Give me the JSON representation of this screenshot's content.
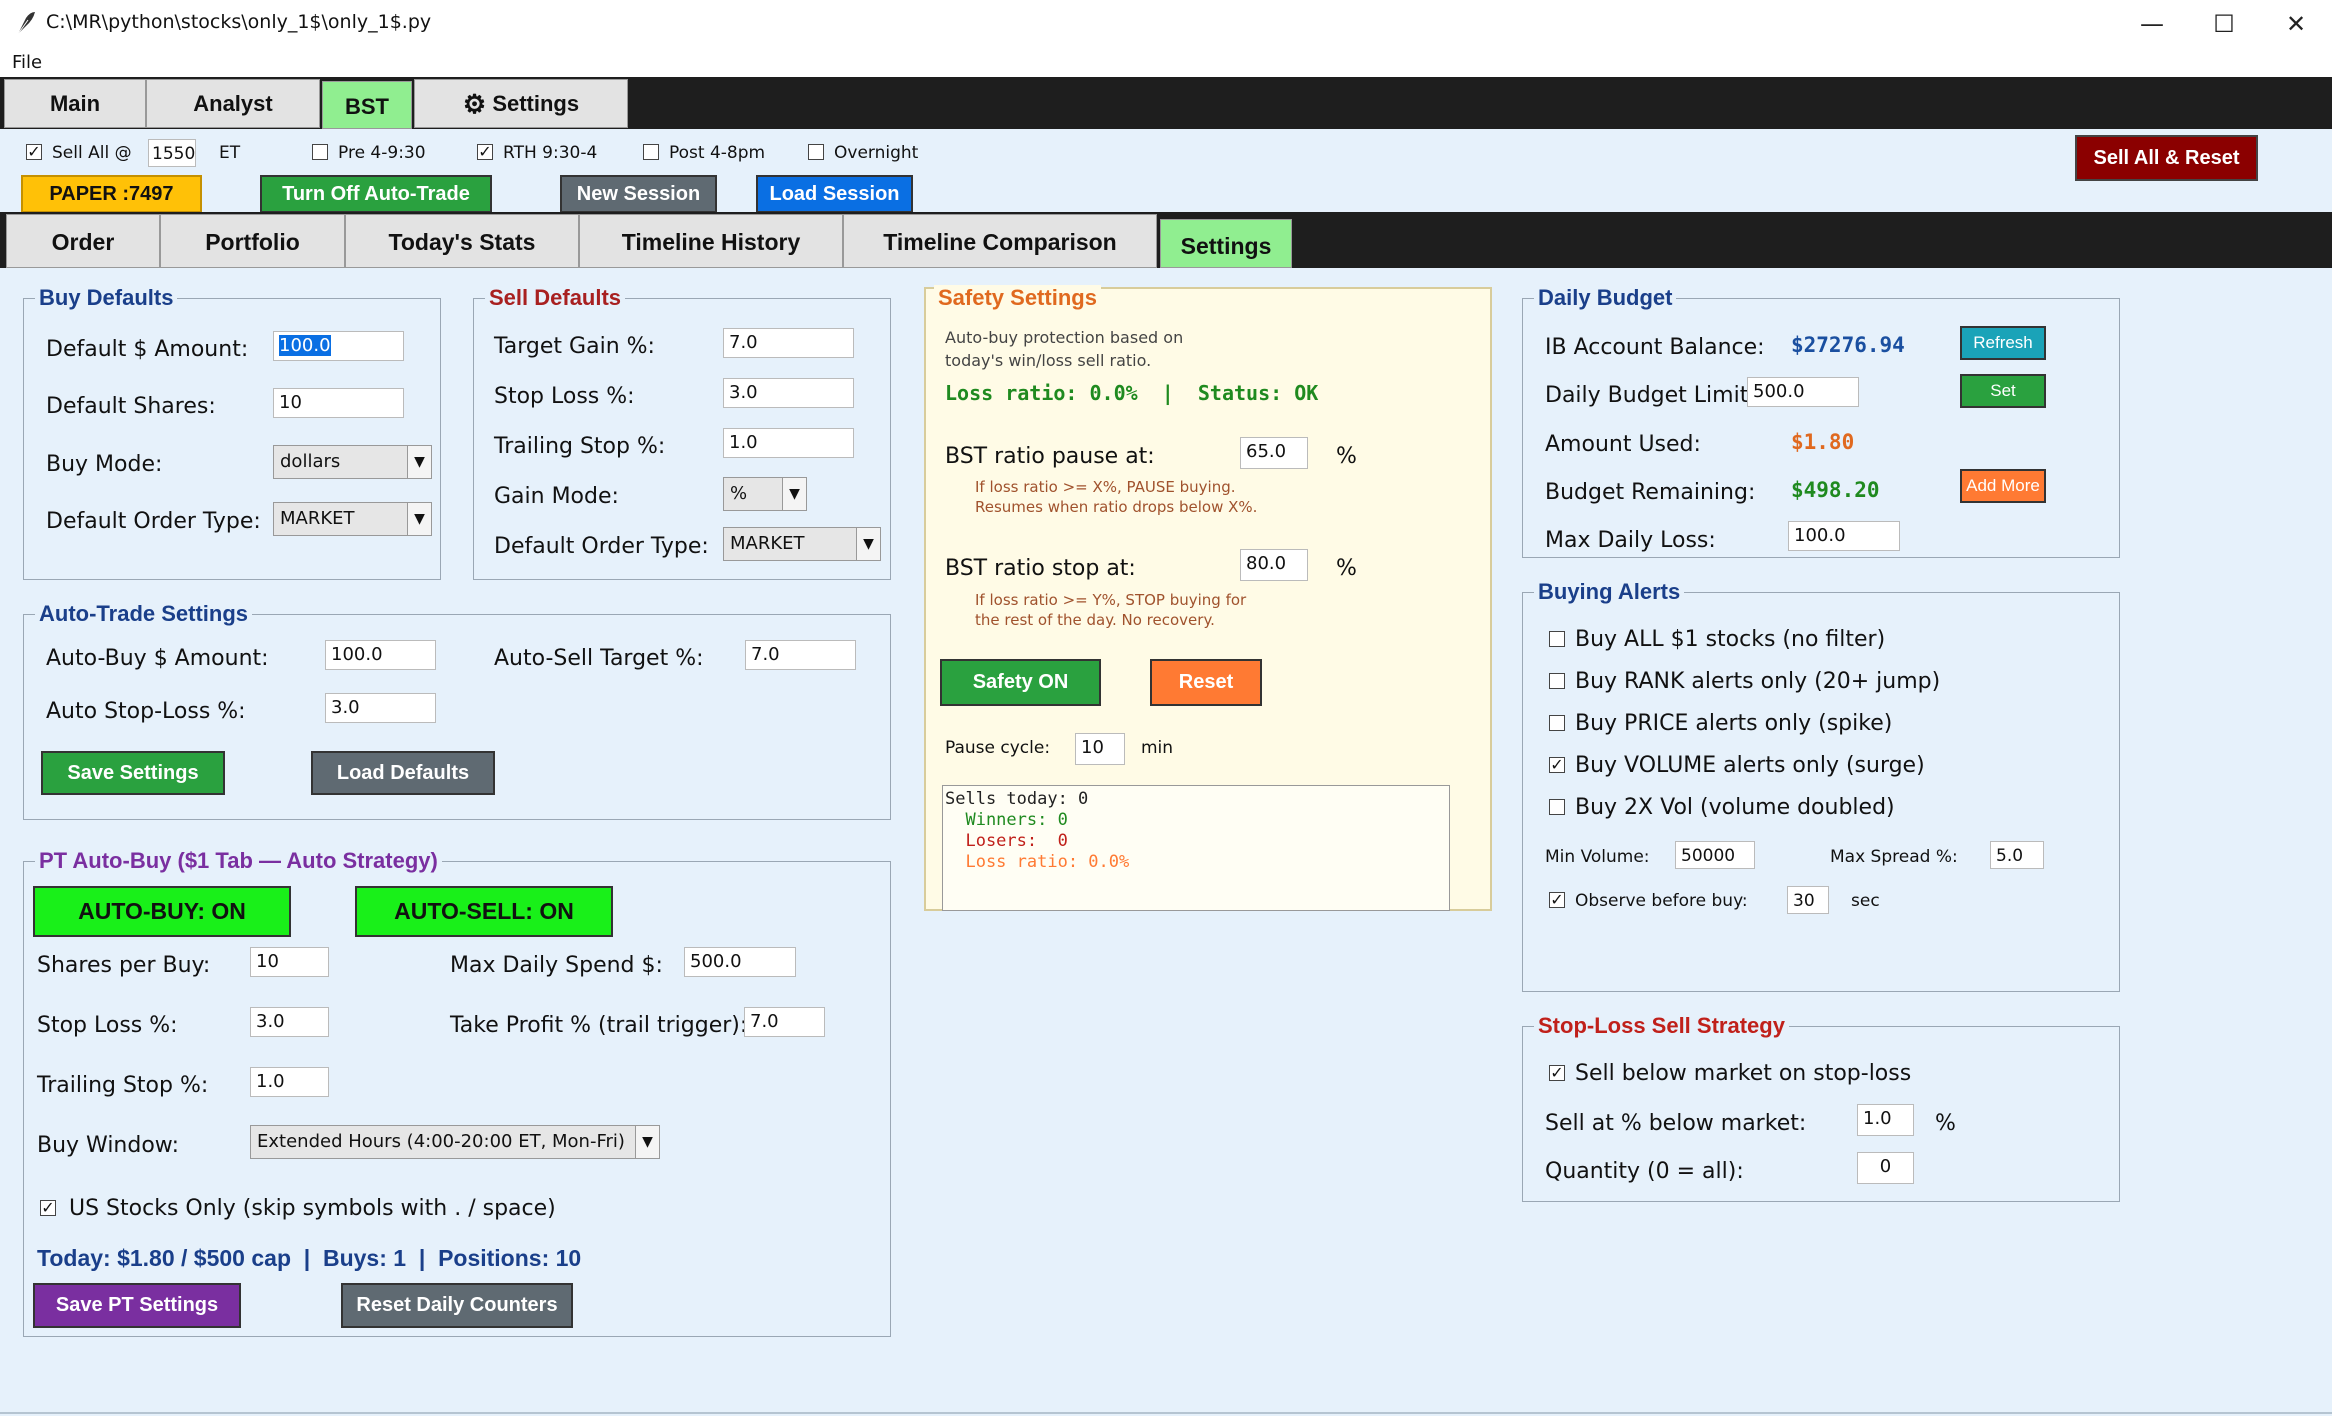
{
  "window": {
    "title": "C:\\MR\\python\\stocks\\only_1$\\only_1$.py",
    "minimize": "—",
    "maximize": "☐",
    "close": "✕"
  },
  "menu": {
    "file": "File"
  },
  "main_tabs": [
    "Main",
    "Analyst",
    "BST",
    "Settings"
  ],
  "gear_glyph": "⚙",
  "toolbar": {
    "sell_all_label": "Sell All @",
    "sell_all_time": "1550",
    "et": "ET",
    "pre": "Pre 4-9:30",
    "rth": "RTH 9:30-4",
    "post": "Post 4-8pm",
    "overnight": "Overnight",
    "sell_all_reset": "Sell All & Reset",
    "paper": "PAPER :7497",
    "turn_off": "Turn Off Auto-Trade",
    "new_session": "New Session",
    "load_session": "Load Session",
    "check": "✓"
  },
  "sub_tabs": [
    "Order",
    "Portfolio",
    "Today's Stats",
    "Timeline History",
    "Timeline Comparison",
    "Settings"
  ],
  "buy_defaults": {
    "title": "Buy Defaults",
    "amount_label": "Default $ Amount:",
    "amount": "100.0",
    "shares_label": "Default Shares:",
    "shares": "10",
    "mode_label": "Buy Mode:",
    "mode": "dollars",
    "order_type_label": "Default Order Type:",
    "order_type": "MARKET"
  },
  "sell_defaults": {
    "title": "Sell Defaults",
    "target_label": "Target Gain %:",
    "target": "7.0",
    "stop_label": "Stop Loss %:",
    "stop": "3.0",
    "trail_label": "Trailing Stop %:",
    "trail": "1.0",
    "gain_mode_label": "Gain Mode:",
    "gain_mode": "%",
    "order_type_label": "Default Order Type:",
    "order_type": "MARKET"
  },
  "auto_trade": {
    "title": "Auto-Trade Settings",
    "buy_amount_label": "Auto-Buy $ Amount:",
    "buy_amount": "100.0",
    "sell_target_label": "Auto-Sell Target %:",
    "sell_target": "7.0",
    "stop_label": "Auto Stop-Loss %:",
    "stop": "3.0",
    "save": "Save Settings",
    "load": "Load Defaults"
  },
  "pt": {
    "title": "PT Auto-Buy  ($1 Tab — Auto Strategy)",
    "auto_buy": "AUTO-BUY: ON",
    "auto_sell": "AUTO-SELL: ON",
    "shares_label": "Shares per Buy:",
    "shares": "10",
    "max_spend_label": "Max Daily Spend $:",
    "max_spend": "500.0",
    "stop_label": "Stop Loss %:",
    "stop": "3.0",
    "take_profit_label": "Take Profit % (trail trigger):",
    "take_profit": "7.0",
    "trail_label": "Trailing Stop %:",
    "trail": "1.0",
    "window_label": "Buy Window:",
    "window": "Extended Hours  (4:00-20:00 ET, Mon-Fri)",
    "us_only": "US Stocks Only (skip symbols with . / space)",
    "summary": "Today: $1.80 / $500 cap  |  Buys: 1  |  Positions: 10",
    "save": "Save PT Settings",
    "reset": "Reset Daily Counters"
  },
  "safety": {
    "title": "Safety Settings",
    "desc1": "Auto-buy protection based on",
    "desc2": "today's win/loss sell ratio.",
    "status": "Loss ratio: 0.0%  |  Status: OK",
    "pause_label": "BST ratio pause at:",
    "pause": "65.0",
    "pct": "%",
    "pause_note1": "If loss ratio >= X%, PAUSE buying.",
    "pause_note2": "Resumes when ratio drops below X%.",
    "stop_label": "BST ratio stop at:",
    "stop": "80.0",
    "stop_note1": "If loss ratio >= Y%, STOP buying for",
    "stop_note2": "the rest of the day. No recovery.",
    "on": "Safety ON",
    "reset": "Reset",
    "cycle_label": "Pause cycle:",
    "cycle": "10",
    "min": "min",
    "log1": "Sells today: 0",
    "log2": "  Winners: 0",
    "log3": "  Losers:  0",
    "log4": "  Loss ratio: 0.0%"
  },
  "budget": {
    "title": "Daily Budget",
    "balance_label": "IB Account Balance:",
    "balance": "$27276.94",
    "refresh": "Refresh",
    "limit_label": "Daily Budget Limit:",
    "limit": "500.0",
    "set": "Set",
    "used_label": "Amount Used:",
    "used": "$1.80",
    "remaining_label": "Budget Remaining:",
    "remaining": "$498.20",
    "add_more": "Add More",
    "max_loss_label": "Max Daily Loss:",
    "max_loss": "100.0"
  },
  "alerts": {
    "title": "Buying Alerts",
    "a1": "Buy ALL $1 stocks (no filter)",
    "a2": "Buy RANK alerts only (20+ jump)",
    "a3": "Buy PRICE alerts only (spike)",
    "a4": "Buy VOLUME alerts only (surge)",
    "a5": "Buy 2X Vol (volume doubled)",
    "min_vol_label": "Min Volume:",
    "min_vol": "50000",
    "max_spread_label": "Max Spread %:",
    "max_spread": "5.0",
    "observe_label": "Observe before buy:",
    "observe": "30",
    "sec": "sec"
  },
  "stoploss": {
    "title": "Stop-Loss Sell Strategy",
    "below_market": "Sell below market on stop-loss",
    "pct_label": "Sell at % below market:",
    "pct": "1.0",
    "pct_sign": "%",
    "qty_label": "Quantity (0 = all):",
    "qty": "0"
  },
  "colors": {
    "green": "#2aa13f",
    "bright_green": "#19f019",
    "dark_red": "#8b0000",
    "orange": "#ff7a33",
    "blue": "#0a6fe3",
    "gray": "#5f6a72",
    "purple": "#7a2fa0",
    "yellow": "#ffc107",
    "teal": "#1aa3b8",
    "navy": "#1a3f8a"
  }
}
